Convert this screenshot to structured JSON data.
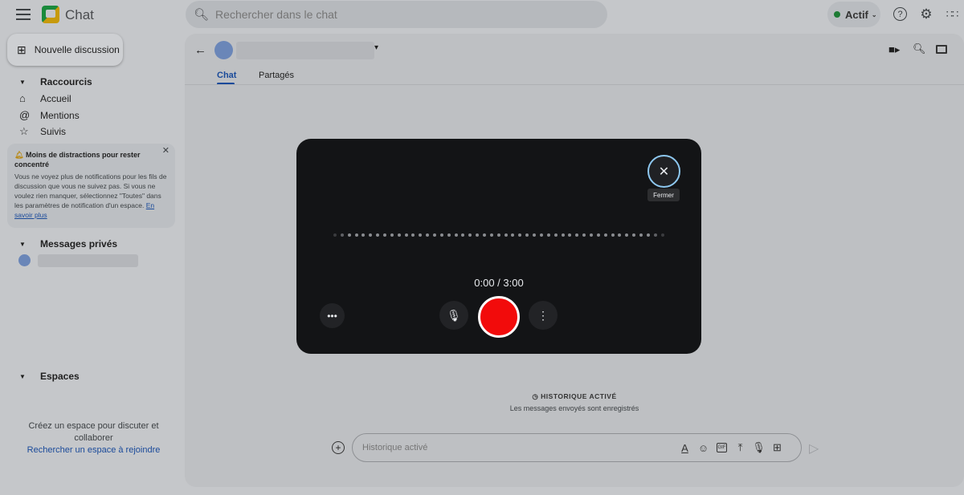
{
  "app": {
    "title": "Chat"
  },
  "search": {
    "placeholder": "Rechercher dans le chat"
  },
  "status": {
    "label": "Actif",
    "color": "#1e7b34"
  },
  "sidebar": {
    "new_chat": "Nouvelle discussion",
    "shortcuts": {
      "title": "Raccourcis",
      "items": [
        {
          "label": "Accueil",
          "icon": "home-icon"
        },
        {
          "label": "Mentions",
          "icon": "at-icon"
        },
        {
          "label": "Suivis",
          "icon": "star-icon"
        }
      ]
    },
    "tip": {
      "title": "Moins de distractions pour rester concentré",
      "body": "Vous ne voyez plus de notifications pour les fils de discussion que vous ne suivez pas. Si vous ne voulez rien manquer, sélectionnez \"Toutes\" dans les paramètres de notification d'un espace.",
      "link": "En savoir plus"
    },
    "dm": {
      "title": "Messages privés"
    },
    "spaces": {
      "title": "Espaces",
      "empty": "Créez un espace pour discuter et collaborer",
      "link": "Rechercher un espace à rejoindre"
    }
  },
  "conversation": {
    "tabs": [
      {
        "label": "Chat",
        "active": true
      },
      {
        "label": "Partagés",
        "active": false
      }
    ]
  },
  "recorder": {
    "close_tooltip": "Fermer",
    "timer": "0:00 / 3:00",
    "record_color": "#f20b0b",
    "progress": 0
  },
  "history": {
    "title": "HISTORIQUE ACTIVÉ",
    "subtitle": "Les messages envoyés sont enregistrés"
  },
  "composer": {
    "placeholder": "Historique activé"
  }
}
